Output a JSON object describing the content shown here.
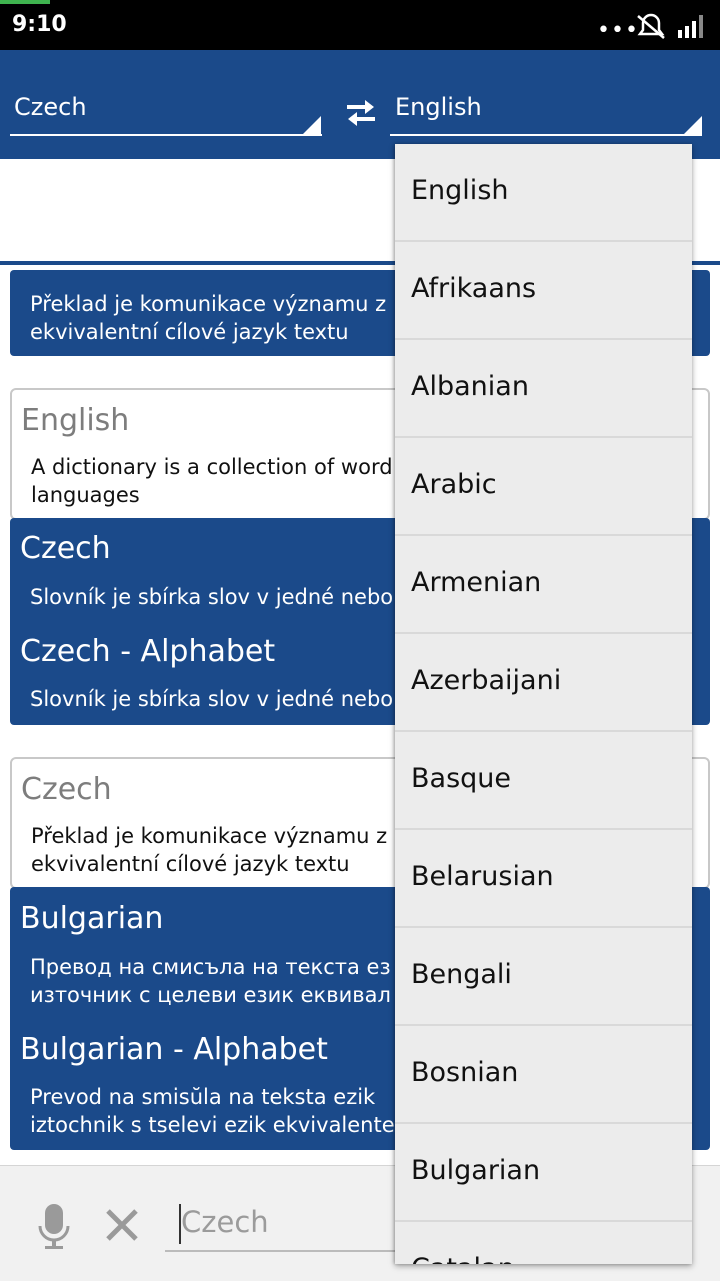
{
  "status_bar": {
    "time": "9:10"
  },
  "toolbar": {
    "source_lang": "Czech",
    "target_lang": "English"
  },
  "cards": [
    {
      "body": "Překlad je komunikace významu z\nekvivalentní cílové jazyk textu"
    },
    {
      "header_title": "English",
      "header_body": "A dictionary is a collection of word\nlanguages",
      "sections": [
        {
          "title": "Czech",
          "body": "Slovník je sbírka slov v jedné nebo"
        },
        {
          "title": "Czech - Alphabet",
          "body": "Slovník je sbírka slov v jedné nebo"
        }
      ]
    },
    {
      "header_title": "Czech",
      "header_body": "Překlad je komunikace významu z\nekvivalentní cílové jazyk textu",
      "sections": [
        {
          "title": "Bulgarian",
          "body": "Превод на смисъла на текста ез\nизточник с целеви език еквивал"
        },
        {
          "title": "Bulgarian - Alphabet",
          "body": "Prevod na smisŭla na teksta ezik\niztochnik s tselevi ezik ekvivalente"
        }
      ]
    }
  ],
  "bottom_bar": {
    "input_value": "Czech"
  },
  "dropdown": {
    "options": [
      "English",
      "Afrikaans",
      "Albanian",
      "Arabic",
      "Armenian",
      "Azerbaijani",
      "Basque",
      "Belarusian",
      "Bengali",
      "Bosnian",
      "Bulgarian",
      "Catalan"
    ]
  },
  "colors": {
    "primary": "#1b4a8a",
    "status_green": "#3fb34f"
  },
  "icons": [
    "swap-arrows-icon",
    "microphone-icon",
    "clear-icon",
    "dropdown-triangle-icon",
    "more-dots-icon",
    "muted-alarm-icon",
    "signal-icon"
  ]
}
